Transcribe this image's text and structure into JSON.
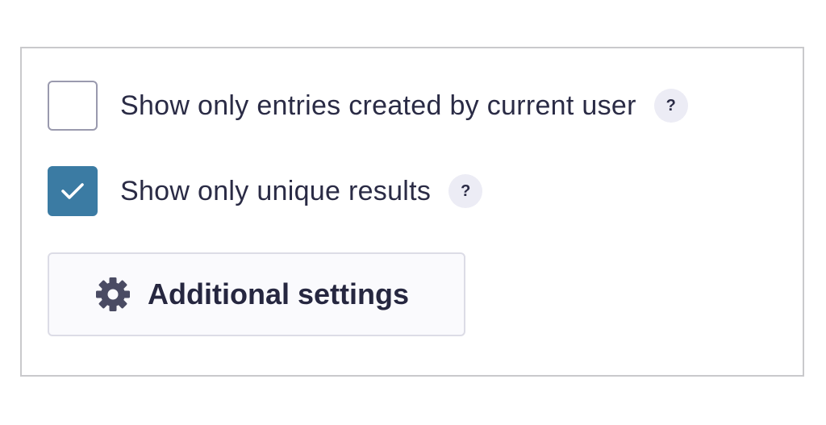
{
  "options": [
    {
      "label": "Show only entries created by current user",
      "checked": false,
      "help_label": "?"
    },
    {
      "label": "Show only unique results",
      "checked": true,
      "help_label": "?"
    }
  ],
  "additional_settings": {
    "label": "Additional settings",
    "icon": "gear-icon"
  },
  "colors": {
    "checkbox_checked": "#3b7ba3",
    "text": "#2a2b45",
    "help_bg": "#ececf5",
    "panel_border": "#c9c9cc"
  }
}
